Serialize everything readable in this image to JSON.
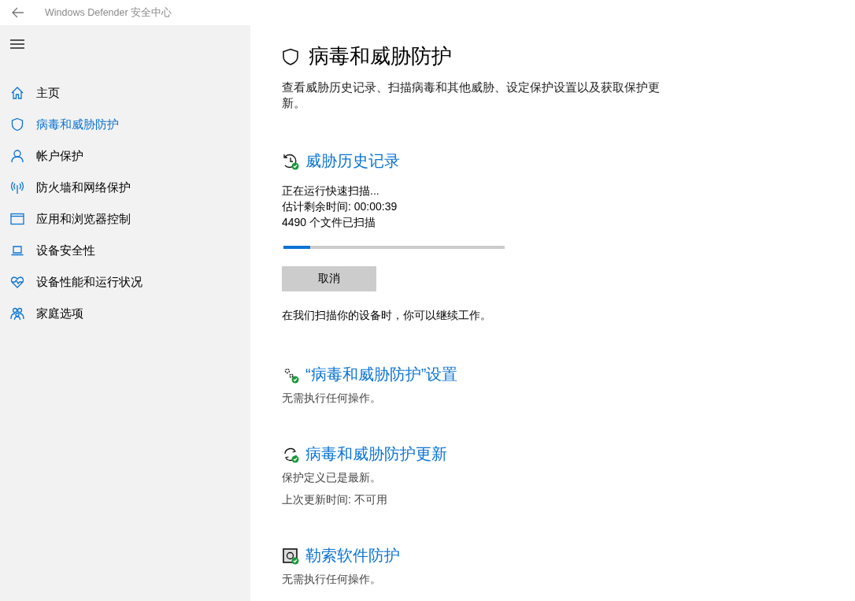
{
  "window": {
    "title": "Windows Defender 安全中心"
  },
  "sidebar": {
    "items": [
      {
        "label": "主页",
        "kind": "home",
        "selected": false
      },
      {
        "label": "病毒和威胁防护",
        "kind": "shield",
        "selected": true
      },
      {
        "label": "帐户保护",
        "kind": "person",
        "selected": false
      },
      {
        "label": "防火墙和网络保护",
        "kind": "antenna",
        "selected": false
      },
      {
        "label": "应用和浏览器控制",
        "kind": "browser",
        "selected": false
      },
      {
        "label": "设备安全性",
        "kind": "laptop",
        "selected": false
      },
      {
        "label": "设备性能和运行状况",
        "kind": "heart",
        "selected": false
      },
      {
        "label": "家庭选项",
        "kind": "family",
        "selected": false
      }
    ]
  },
  "page": {
    "title": "病毒和威胁防护",
    "description": "查看威胁历史记录、扫描病毒和其他威胁、设定保护设置以及获取保护更新。"
  },
  "sections": [
    {
      "kind": "history",
      "heading": "威胁历史记录",
      "scan": {
        "status_lines": [
          "正在运行快速扫描...",
          "估计剩余时间: 00:00:39",
          "4490 个文件已扫描"
        ],
        "level": 0.12,
        "button": "取消",
        "note": "在我们扫描你的设备时，你可以继续工作。"
      }
    },
    {
      "kind": "settings",
      "heading": "“病毒和威胁防护”设置",
      "lines": [
        "无需执行任何操作。"
      ]
    },
    {
      "kind": "update",
      "heading": "病毒和威胁防护更新",
      "lines": [
        "保护定义已是最新。",
        "上次更新时间: 不可用"
      ]
    },
    {
      "kind": "ransomware",
      "heading": "勒索软件防护",
      "lines": [
        "无需执行任何操作。"
      ]
    }
  ]
}
